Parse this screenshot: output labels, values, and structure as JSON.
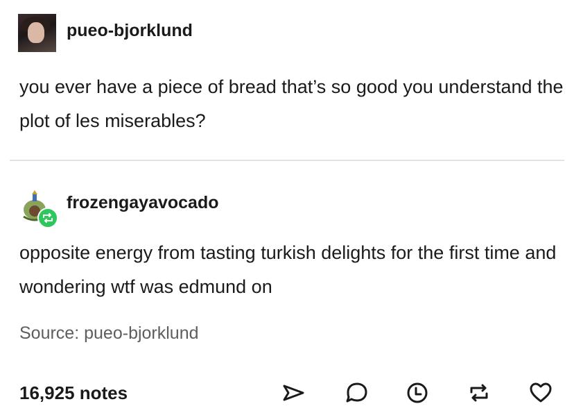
{
  "post": {
    "original": {
      "username": "pueo-bjorklund",
      "text": "you ever have a piece of bread that’s so good you understand the plot of les miserables?"
    },
    "reblog": {
      "username": "frozengayavocado",
      "text": "opposite energy from tasting turkish delights for the first time and wondering wtf was edmund on"
    },
    "source": {
      "label": "Source:",
      "name": "pueo-bjorklund"
    },
    "notes": "16,925 notes",
    "actions": [
      {
        "name": "share",
        "icon": "share-icon"
      },
      {
        "name": "reply",
        "icon": "reply-icon"
      },
      {
        "name": "post-later",
        "icon": "clock-icon"
      },
      {
        "name": "reblog",
        "icon": "reblog-icon"
      },
      {
        "name": "like",
        "icon": "heart-icon"
      }
    ],
    "colors": {
      "reblog_badge": "#2ec75c",
      "text": "#1a1a1a",
      "muted": "#5e5e5e",
      "divider": "#e2e2e2"
    }
  }
}
